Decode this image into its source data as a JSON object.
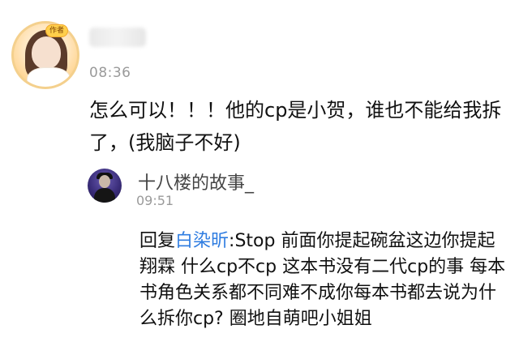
{
  "comment": {
    "avatar_badge": "作者",
    "time": "08:36",
    "text": "怎么可以！！！他的cp是小贺，谁也不能给我拆了，(我脑子不好)"
  },
  "reply": {
    "username": "十八楼的故事_",
    "time": "09:51",
    "prefix": "回复",
    "mention": "白染昕",
    "body": ":Stop 前面你提起碗盆这边你提起翔霖 什么cp不cp 这本书没有二代cp的事 每本书角色关系都不同难不成你每本书都去说为什么拆你cp? 圈地自萌吧小姐姐"
  },
  "colors": {
    "mention": "#2f7de1",
    "timestamp": "#9a9a9a",
    "badge": "#ffcf4b"
  }
}
